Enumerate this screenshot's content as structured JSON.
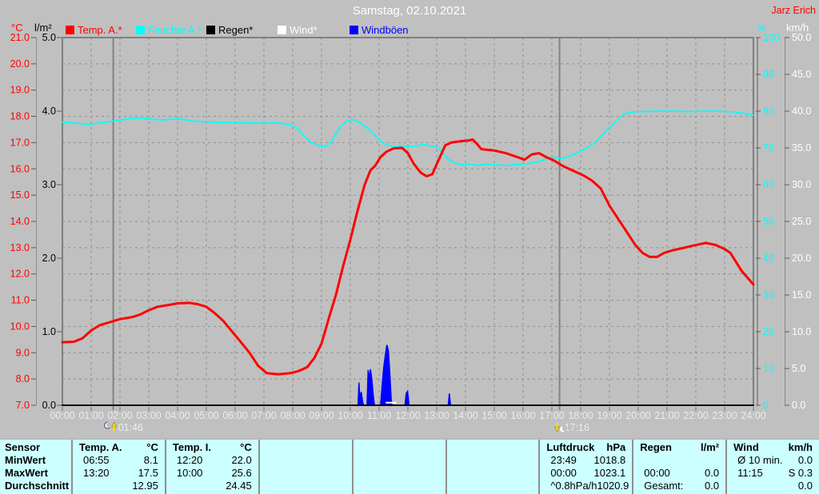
{
  "window": {
    "title": "Samstag, 02.10.2021",
    "user": "Jarz Erich"
  },
  "chart_data": {
    "type": "line",
    "title": "Samstag, 02.10.2021",
    "x_axis": {
      "min": 0,
      "max": 24,
      "step": 1,
      "label_format": "HH:00"
    },
    "grid": {
      "on": true
    },
    "legend_position": "top",
    "axes": {
      "temp": {
        "side": "left",
        "unit": "°C",
        "color": "#ff0000",
        "min": 7,
        "max": 21,
        "step": 1,
        "decimals": 1
      },
      "rain": {
        "side": "left",
        "unit": "l/m²",
        "color": "#000000",
        "min": 0,
        "max": 5,
        "step": 1,
        "decimals": 1
      },
      "humidity": {
        "side": "right",
        "unit": "%",
        "color": "#00ffff",
        "min": 0,
        "max": 100,
        "step": 10,
        "decimals": 0
      },
      "wind": {
        "side": "right",
        "unit": "km/h",
        "color": "#ffffff",
        "min": 0,
        "max": 50,
        "step": 5,
        "decimals": 1
      }
    },
    "series": [
      {
        "name": "Temp. A.*",
        "axis": "temp",
        "color": "#ff0000",
        "width": 3,
        "points": [
          [
            0,
            9.4
          ],
          [
            0.4,
            9.42
          ],
          [
            0.7,
            9.55
          ],
          [
            1,
            9.85
          ],
          [
            1.3,
            10.05
          ],
          [
            1.7,
            10.18
          ],
          [
            2,
            10.28
          ],
          [
            2.4,
            10.35
          ],
          [
            2.7,
            10.45
          ],
          [
            3,
            10.62
          ],
          [
            3.3,
            10.75
          ],
          [
            3.7,
            10.82
          ],
          [
            4,
            10.88
          ],
          [
            4.4,
            10.9
          ],
          [
            4.7,
            10.85
          ],
          [
            5,
            10.75
          ],
          [
            5.3,
            10.5
          ],
          [
            5.6,
            10.2
          ],
          [
            5.9,
            9.8
          ],
          [
            6.2,
            9.4
          ],
          [
            6.5,
            9.0
          ],
          [
            6.8,
            8.5
          ],
          [
            7.1,
            8.22
          ],
          [
            7.5,
            8.18
          ],
          [
            7.9,
            8.22
          ],
          [
            8.2,
            8.3
          ],
          [
            8.5,
            8.45
          ],
          [
            8.75,
            8.8
          ],
          [
            9,
            9.35
          ],
          [
            9.25,
            10.3
          ],
          [
            9.5,
            11.2
          ],
          [
            9.75,
            12.3
          ],
          [
            10,
            13.3
          ],
          [
            10.25,
            14.4
          ],
          [
            10.5,
            15.4
          ],
          [
            10.7,
            15.95
          ],
          [
            10.85,
            16.1
          ],
          [
            11.05,
            16.45
          ],
          [
            11.25,
            16.65
          ],
          [
            11.5,
            16.78
          ],
          [
            11.8,
            16.8
          ],
          [
            12,
            16.6
          ],
          [
            12.2,
            16.2
          ],
          [
            12.45,
            15.85
          ],
          [
            12.65,
            15.72
          ],
          [
            12.85,
            15.8
          ],
          [
            13.05,
            16.3
          ],
          [
            13.3,
            16.9
          ],
          [
            13.5,
            17.0
          ],
          [
            13.8,
            17.05
          ],
          [
            14.1,
            17.08
          ],
          [
            14.25,
            17.12
          ],
          [
            14.4,
            16.95
          ],
          [
            14.55,
            16.75
          ],
          [
            15,
            16.7
          ],
          [
            15.4,
            16.6
          ],
          [
            15.8,
            16.45
          ],
          [
            16.05,
            16.35
          ],
          [
            16.3,
            16.55
          ],
          [
            16.55,
            16.6
          ],
          [
            16.8,
            16.45
          ],
          [
            17.05,
            16.33
          ],
          [
            17.4,
            16.1
          ],
          [
            17.8,
            15.9
          ],
          [
            18.1,
            15.75
          ],
          [
            18.4,
            15.55
          ],
          [
            18.7,
            15.25
          ],
          [
            19,
            14.6
          ],
          [
            19.3,
            14.1
          ],
          [
            19.6,
            13.6
          ],
          [
            19.9,
            13.1
          ],
          [
            20.15,
            12.8
          ],
          [
            20.4,
            12.65
          ],
          [
            20.65,
            12.65
          ],
          [
            20.9,
            12.8
          ],
          [
            21.2,
            12.9
          ],
          [
            21.6,
            13.0
          ],
          [
            22,
            13.1
          ],
          [
            22.35,
            13.18
          ],
          [
            22.7,
            13.1
          ],
          [
            23,
            12.95
          ],
          [
            23.2,
            12.8
          ],
          [
            23.4,
            12.45
          ],
          [
            23.6,
            12.1
          ],
          [
            23.8,
            11.85
          ],
          [
            24,
            11.6
          ]
        ]
      },
      {
        "name": "Feuchte A.*",
        "axis": "humidity",
        "color": "#00ffff",
        "width": 1.8,
        "points": [
          [
            0,
            77
          ],
          [
            0.5,
            76.7
          ],
          [
            0.9,
            76.4
          ],
          [
            1.3,
            76.8
          ],
          [
            1.8,
            77.3
          ],
          [
            2.3,
            77.9
          ],
          [
            2.6,
            78.2
          ],
          [
            3,
            77.9
          ],
          [
            3.4,
            77.6
          ],
          [
            3.8,
            77.8
          ],
          [
            4.1,
            77.9
          ],
          [
            4.5,
            77.3
          ],
          [
            5,
            77.1
          ],
          [
            5.6,
            76.9
          ],
          [
            6.3,
            76.8
          ],
          [
            7,
            76.7
          ],
          [
            7.5,
            76.8
          ],
          [
            7.9,
            76.3
          ],
          [
            8.15,
            75.4
          ],
          [
            8.4,
            73.2
          ],
          [
            8.65,
            71.4
          ],
          [
            8.9,
            70.6
          ],
          [
            9.1,
            70.2
          ],
          [
            9.3,
            71.3
          ],
          [
            9.5,
            73.8
          ],
          [
            9.7,
            76.2
          ],
          [
            9.9,
            77.4
          ],
          [
            10.1,
            77.7
          ],
          [
            10.35,
            76.8
          ],
          [
            10.6,
            75.3
          ],
          [
            10.85,
            73.4
          ],
          [
            11.1,
            71.5
          ],
          [
            11.3,
            70.7
          ],
          [
            11.55,
            70.3
          ],
          [
            11.75,
            70.6
          ],
          [
            12,
            70.2
          ],
          [
            12.3,
            70.6
          ],
          [
            12.55,
            70.9
          ],
          [
            12.8,
            70.5
          ],
          [
            13,
            70.2
          ],
          [
            13.2,
            68.8
          ],
          [
            13.4,
            66.9
          ],
          [
            13.65,
            65.8
          ],
          [
            13.9,
            65.3
          ],
          [
            14.15,
            65.6
          ],
          [
            14.45,
            65.2
          ],
          [
            14.75,
            65.6
          ],
          [
            15.05,
            65.4
          ],
          [
            15.4,
            65.2
          ],
          [
            15.8,
            65.5
          ],
          [
            16.15,
            65.7
          ],
          [
            16.5,
            66.2
          ],
          [
            16.8,
            66.9
          ],
          [
            17.05,
            67.4
          ],
          [
            17.25,
            67.1
          ],
          [
            17.5,
            67.4
          ],
          [
            17.8,
            68.3
          ],
          [
            18.1,
            69.5
          ],
          [
            18.45,
            71.2
          ],
          [
            18.75,
            73.5
          ],
          [
            19,
            75.5
          ],
          [
            19.25,
            77.5
          ],
          [
            19.5,
            79.2
          ],
          [
            19.8,
            79.8
          ],
          [
            20.2,
            79.9
          ],
          [
            21,
            80
          ],
          [
            21.8,
            79.9
          ],
          [
            22.6,
            80
          ],
          [
            23.3,
            79.8
          ],
          [
            23.7,
            79.3
          ],
          [
            24,
            78.9
          ]
        ]
      },
      {
        "name": "Regen*",
        "axis": "rain",
        "color": "#000000",
        "width": 2,
        "points": [
          [
            0,
            0
          ],
          [
            24,
            0
          ]
        ]
      },
      {
        "name": "Wind*",
        "axis": "wind",
        "color": "#ffffff",
        "width": 2,
        "points": [
          [
            11.25,
            0.35
          ],
          [
            11.58,
            0.35
          ]
        ]
      },
      {
        "name": "Windböen",
        "axis": "wind",
        "color": "#0000ff",
        "width": 1.5,
        "clusters": [
          [
            [
              10.27,
              0
            ],
            [
              10.3,
              3.1
            ],
            [
              10.33,
              1.0
            ],
            [
              10.38,
              1.8
            ],
            [
              10.43,
              0.4
            ],
            [
              10.46,
              0
            ]
          ],
          [
            [
              10.58,
              0
            ],
            [
              10.62,
              4.8
            ],
            [
              10.66,
              3.6
            ],
            [
              10.7,
              4.9
            ],
            [
              10.75,
              3.4
            ],
            [
              10.8,
              1.2
            ],
            [
              10.84,
              0
            ]
          ],
          [
            [
              11.05,
              0
            ],
            [
              11.1,
              2.4
            ],
            [
              11.16,
              5.2
            ],
            [
              11.22,
              6.9
            ],
            [
              11.27,
              8.2
            ],
            [
              11.32,
              7.5
            ],
            [
              11.37,
              4.5
            ],
            [
              11.42,
              0.8
            ],
            [
              11.45,
              0
            ]
          ],
          [
            [
              11.9,
              0
            ],
            [
              11.94,
              1.6
            ],
            [
              11.99,
              1.9
            ],
            [
              12.04,
              0
            ]
          ],
          [
            [
              13.4,
              0
            ],
            [
              13.44,
              1.6
            ],
            [
              13.48,
              0
            ]
          ]
        ]
      }
    ],
    "markers": [
      {
        "t": 1.767,
        "label": "01:46",
        "icon": "moonrise"
      },
      {
        "t": 17.267,
        "label": "17:16",
        "icon": "moonset"
      }
    ]
  },
  "stats_table": {
    "background": "#ccffff",
    "row_labels": [
      "Sensor",
      "MinWert",
      "MaxWert",
      "Durchschnitt"
    ],
    "columns": [
      {
        "name": "Temp. A.",
        "unit": "°C",
        "rows": [
          [
            "06:55",
            "8.1"
          ],
          [
            "13:20",
            "17.5"
          ],
          [
            "",
            "12.95"
          ]
        ]
      },
      {
        "name": "Temp. I.",
        "unit": "°C",
        "rows": [
          [
            "12:20",
            "22.0"
          ],
          [
            "10:00",
            "25.6"
          ],
          [
            "",
            "24.45"
          ]
        ]
      },
      {
        "name": "",
        "unit": "",
        "rows": [
          [
            "",
            ""
          ],
          [
            "",
            ""
          ],
          [
            "",
            ""
          ]
        ]
      },
      {
        "name": "",
        "unit": "",
        "rows": [
          [
            "",
            ""
          ],
          [
            "",
            ""
          ],
          [
            "",
            ""
          ]
        ]
      },
      {
        "name": "",
        "unit": "",
        "rows": [
          [
            "",
            ""
          ],
          [
            "",
            ""
          ],
          [
            "",
            ""
          ]
        ]
      },
      {
        "name": "Luftdruck",
        "unit": "hPa",
        "rows": [
          [
            "23:49",
            "1018.8"
          ],
          [
            "00:00",
            "1023.1"
          ],
          [
            "^0.8hPa/h",
            "1020.9"
          ]
        ]
      },
      {
        "name": "Regen",
        "unit": "l/m²",
        "rows": [
          [
            "",
            ""
          ],
          [
            "00:00",
            "0.0"
          ],
          [
            "Gesamt:",
            "0.0"
          ]
        ]
      },
      {
        "name": "Wind",
        "unit": "km/h",
        "rows": [
          [
            "Ø 10 min.",
            "0.0"
          ],
          [
            "11:15",
            "S 0.3"
          ],
          [
            "",
            "0.0"
          ]
        ]
      }
    ]
  }
}
